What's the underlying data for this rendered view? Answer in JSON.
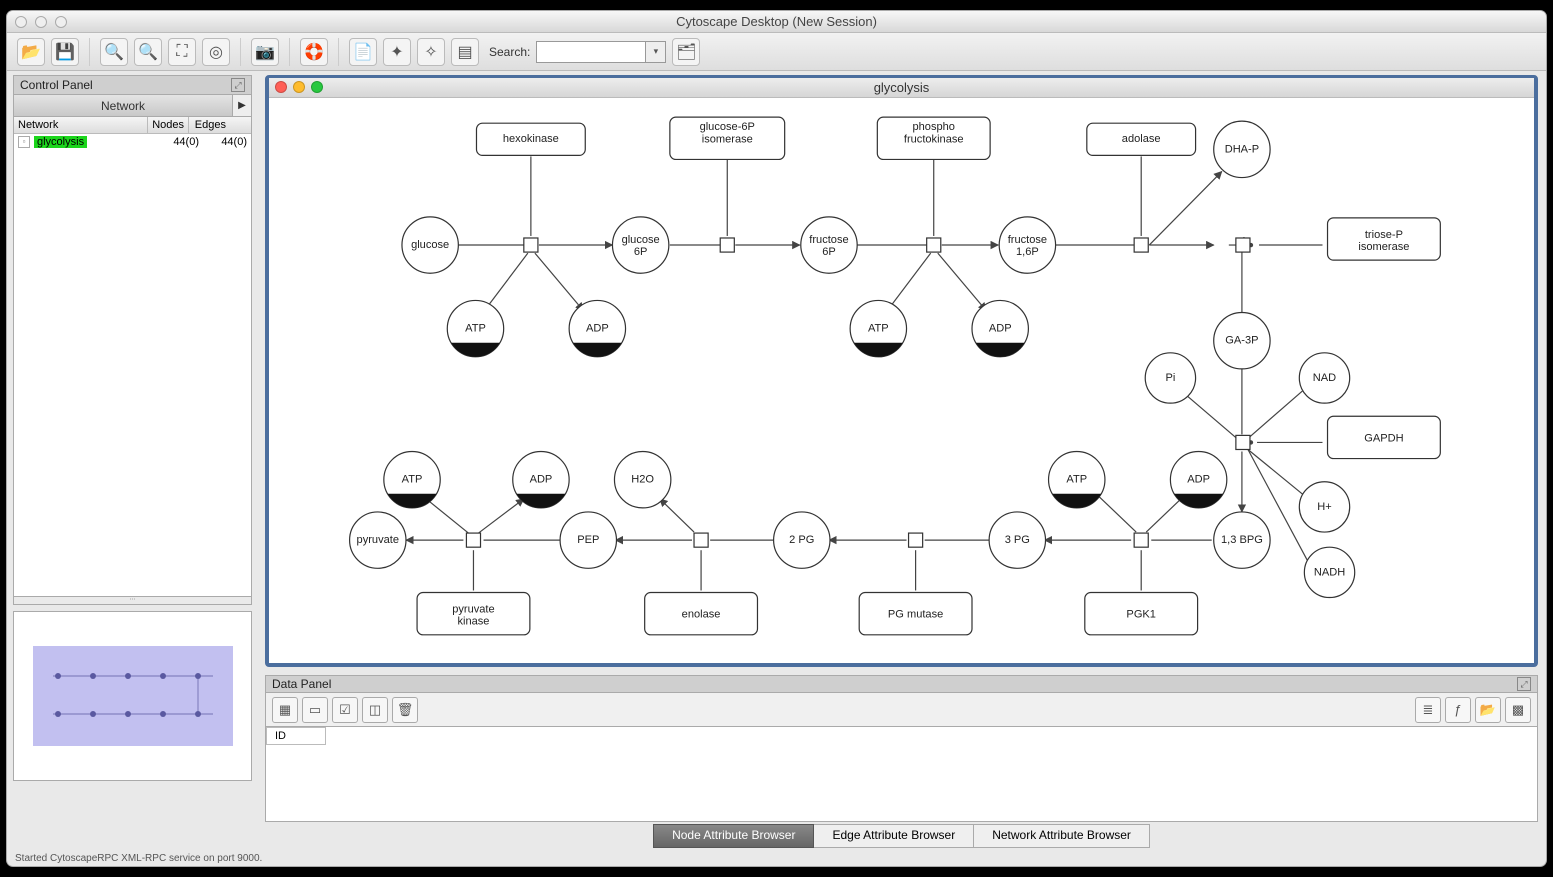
{
  "window": {
    "title": "Cytoscape Desktop (New Session)"
  },
  "toolbar": {
    "search_label": "Search:",
    "search_value": ""
  },
  "control_panel": {
    "title": "Control Panel",
    "tab": "Network",
    "columns": {
      "c1": "Network",
      "c2": "Nodes",
      "c3": "Edges"
    },
    "row": {
      "name": "glycolysis",
      "nodes": "44(0)",
      "edges": "44(0)"
    }
  },
  "netview": {
    "title": "glycolysis"
  },
  "nodes": {
    "hexokinase": "hexokinase",
    "g6p_iso": "glucose-6P isomerase",
    "pfk": "phospho fructokinase",
    "adolase": "adolase",
    "tpi": "triose-P isomerase",
    "gapdh": "GAPDH",
    "pgk1": "PGK1",
    "pgmutase": "PG mutase",
    "enolase": "enolase",
    "pyrk": "pyruvate kinase",
    "glucose": "glucose",
    "g6p": "glucose 6P",
    "f6p": "fructose 6P",
    "f16p": "fructose 1,6P",
    "dhap": "DHA-P",
    "ga3p": "GA-3P",
    "pi": "Pi",
    "nad": "NAD",
    "hplus": "H+",
    "nadh": "NADH",
    "bpg13": "1,3 BPG",
    "pg3": "3 PG",
    "pg2": "2 PG",
    "pep": "PEP",
    "pyruvate": "pyruvate",
    "h2o": "H2O",
    "atp": "ATP",
    "adp": "ADP"
  },
  "data_panel": {
    "title": "Data Panel",
    "col_id": "ID",
    "tabs": {
      "node": "Node Attribute Browser",
      "edge": "Edge Attribute Browser",
      "network": "Network Attribute Browser"
    }
  },
  "status": "Started CytoscapeRPC XML-RPC service on port 9000."
}
